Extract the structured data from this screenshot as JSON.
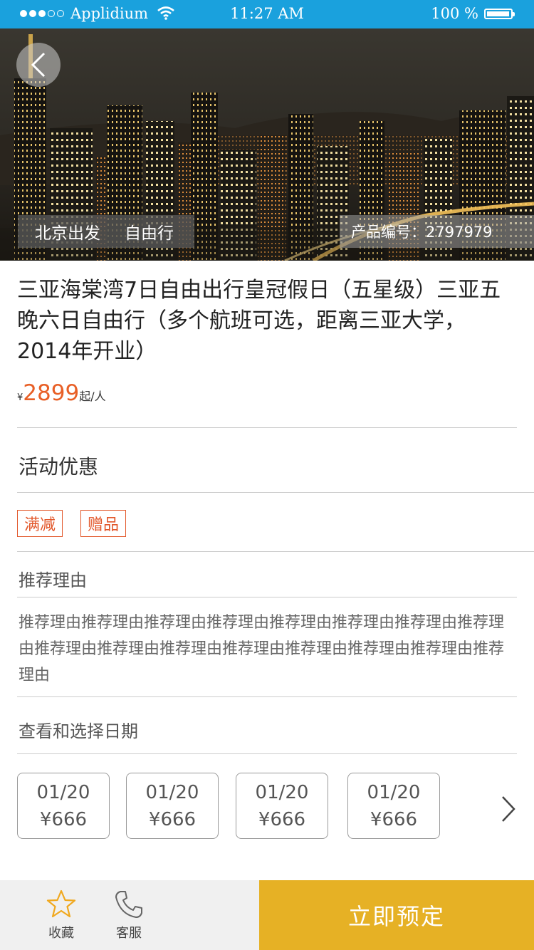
{
  "status_bar": {
    "carrier": "Applidium",
    "time": "11:27 AM",
    "battery": "100 %"
  },
  "hero": {
    "departure": "北京出发",
    "trip_type": "自由行",
    "product_code": "产品编号：2797979"
  },
  "product": {
    "title": "三亚海棠湾7日自由出行皇冠假日（五星级）三亚五晚六日自由行（多个航班可选，距离三亚大学，2014年开业）",
    "currency": "¥",
    "price": "2899",
    "price_unit": "起/人"
  },
  "promotions": {
    "title": "活动优惠",
    "tags": [
      "满减",
      "赠品"
    ]
  },
  "recommendation": {
    "title": "推荐理由",
    "text": "推荐理由推荐理由推荐理由推荐理由推荐理由推荐理由推荐理由推荐理由推荐理由推荐理由推荐理由推荐理由推荐理由推荐理由推荐理由推荐理由"
  },
  "dates": {
    "title": "查看和选择日期",
    "items": [
      {
        "date": "01/20",
        "price": "¥666"
      },
      {
        "date": "01/20",
        "price": "¥666"
      },
      {
        "date": "01/20",
        "price": "¥666"
      },
      {
        "date": "01/20",
        "price": "¥666"
      }
    ]
  },
  "bottom_bar": {
    "favorite_label": "收藏",
    "service_label": "客服",
    "reserve_label": "立即预定"
  },
  "colors": {
    "status_bar": "#1aa1dd",
    "price": "#e85f26",
    "promo_tag": "#e2572a",
    "reserve_button": "#e6b125",
    "star_icon": "#f0a81e"
  },
  "icons": [
    "back-arrow-icon",
    "wifi-icon",
    "battery-icon",
    "star-icon",
    "phone-icon",
    "chevron-right-icon"
  ]
}
